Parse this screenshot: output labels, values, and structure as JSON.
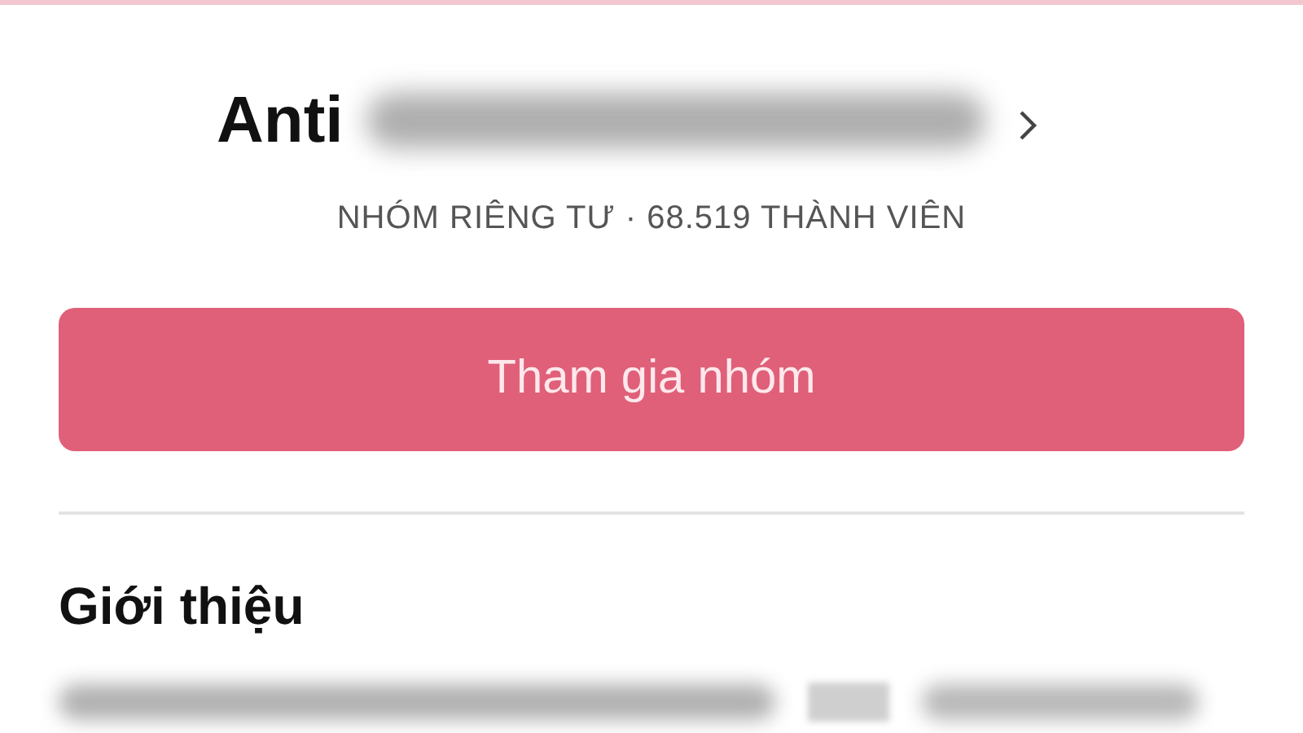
{
  "group": {
    "name": "Anti",
    "meta": "NHÓM RIÊNG TƯ · 68.519 THÀNH VIÊN"
  },
  "join_button": {
    "label": "Tham gia nhóm"
  },
  "about": {
    "heading": "Giới thiệu"
  }
}
